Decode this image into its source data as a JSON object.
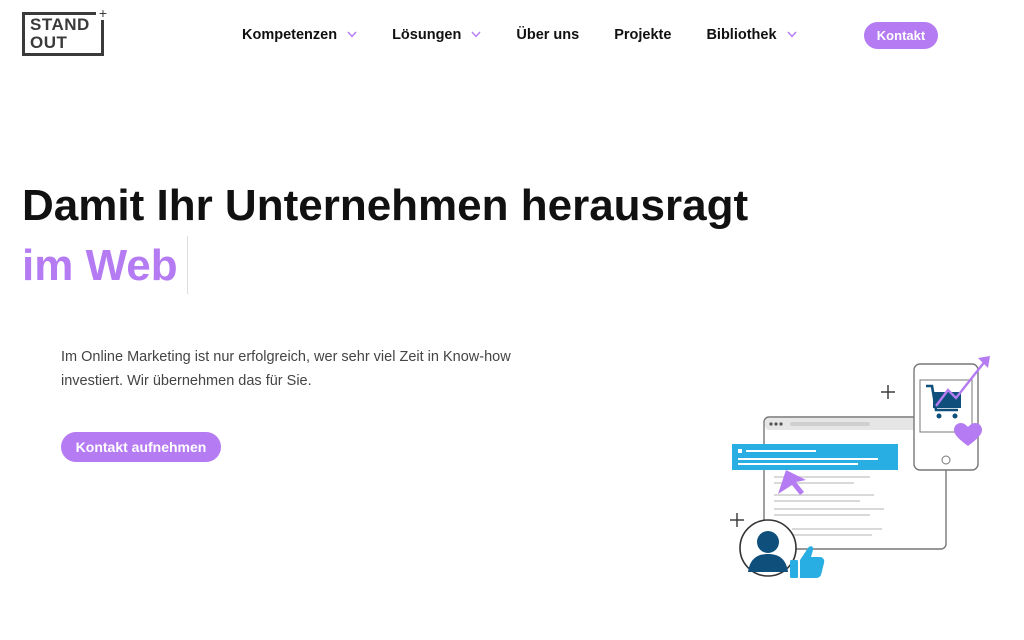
{
  "logo": {
    "line1": "STAND",
    "line2": "OUT",
    "plus": "+"
  },
  "nav": {
    "items": [
      {
        "label": "Kompetenzen",
        "dropdown": true
      },
      {
        "label": "Lösungen",
        "dropdown": true
      },
      {
        "label": "Über uns",
        "dropdown": false
      },
      {
        "label": "Projekte",
        "dropdown": false
      },
      {
        "label": "Bibliothek",
        "dropdown": true
      }
    ],
    "contact_label": "Kontakt"
  },
  "hero": {
    "title": "Damit Ihr Unternehmen herausragt",
    "accent": "im Web",
    "text": "Im Online Marketing ist nur erfolgreich, wer sehr viel Zeit in Know-how investiert. Wir übernehmen das für Sie.",
    "cta_label": "Kontakt aufnehmen"
  },
  "colors": {
    "accent": "#b57bf2",
    "text": "#111111",
    "illustration_blue": "#29aee4",
    "illustration_dark_blue": "#0f4f7c"
  },
  "icons": [
    "chevron-down-icon",
    "plus-icon",
    "shopping-cart-icon",
    "trend-arrow-icon",
    "heart-icon",
    "cursor-icon",
    "user-icon",
    "thumbs-up-icon"
  ]
}
